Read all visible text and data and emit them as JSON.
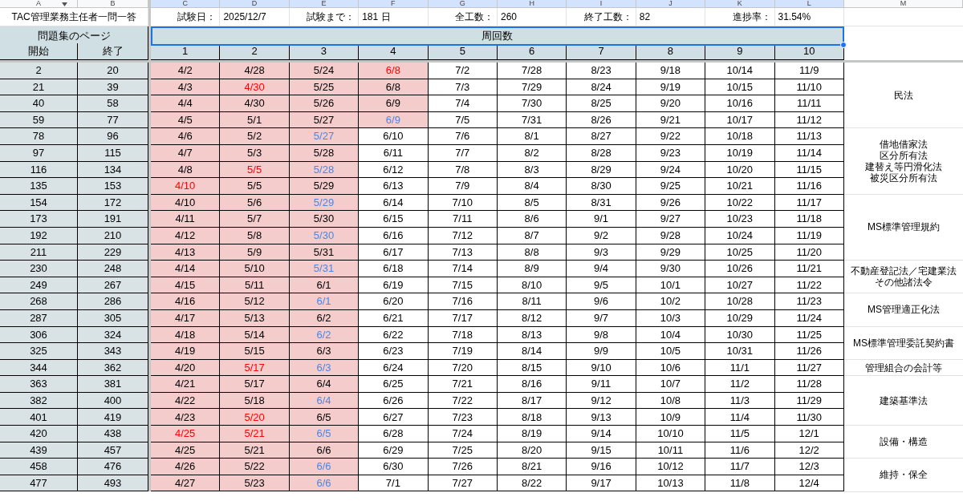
{
  "column_letters": [
    {
      "text": "A",
      "selected": false
    },
    {
      "text": "B",
      "selected": false
    },
    {
      "text": "C",
      "selected": true
    },
    {
      "text": "D",
      "selected": true
    },
    {
      "text": "E",
      "selected": true
    },
    {
      "text": "F",
      "selected": true
    },
    {
      "text": "G",
      "selected": true
    },
    {
      "text": "H",
      "selected": true
    },
    {
      "text": "I",
      "selected": true
    },
    {
      "text": "J",
      "selected": true
    },
    {
      "text": "K",
      "selected": true
    },
    {
      "text": "L",
      "selected": true
    },
    {
      "text": "M",
      "selected": false
    }
  ],
  "title": "TAC管理業務主任者一問一答",
  "exam_info": [
    {
      "label": "試験日：",
      "value": "2025/12/7"
    },
    {
      "label": "試験まで：",
      "value": "181 日"
    },
    {
      "label": "全工数：",
      "value": "260"
    },
    {
      "label": "終了工数：",
      "value": "82"
    },
    {
      "label": "進捗率：",
      "value": "31.54%"
    }
  ],
  "pages_header": "問題集のページ",
  "rounds_header": "周回数",
  "start_label": "開始",
  "end_label": "終了",
  "round_numbers": [
    "1",
    "2",
    "3",
    "4",
    "5",
    "6",
    "7",
    "8",
    "9",
    "10"
  ],
  "groups": [
    {
      "lines": [
        "民法"
      ],
      "rows": [
        {
          "start": "2",
          "end": "20",
          "cells": [
            {
              "text": "4/2",
              "done": true,
              "color": "#000000"
            },
            {
              "text": "4/28",
              "done": true,
              "color": "#000000"
            },
            {
              "text": "5/24",
              "done": true,
              "color": "#000000"
            },
            {
              "text": "6/8",
              "done": true,
              "color": "#ff0000"
            },
            {
              "text": "7/2",
              "done": false,
              "color": "#000000"
            },
            {
              "text": "7/28",
              "done": false,
              "color": "#000000"
            },
            {
              "text": "8/23",
              "done": false,
              "color": "#000000"
            },
            {
              "text": "9/18",
              "done": false,
              "color": "#000000"
            },
            {
              "text": "10/14",
              "done": false,
              "color": "#000000"
            },
            {
              "text": "11/9",
              "done": false,
              "color": "#000000"
            }
          ]
        },
        {
          "start": "21",
          "end": "39",
          "cells": [
            {
              "text": "4/3",
              "done": true,
              "color": "#000000"
            },
            {
              "text": "4/30",
              "done": true,
              "color": "#ff0000"
            },
            {
              "text": "5/25",
              "done": true,
              "color": "#000000"
            },
            {
              "text": "6/8",
              "done": true,
              "color": "#000000"
            },
            {
              "text": "7/3",
              "done": false,
              "color": "#000000"
            },
            {
              "text": "7/29",
              "done": false,
              "color": "#000000"
            },
            {
              "text": "8/24",
              "done": false,
              "color": "#000000"
            },
            {
              "text": "9/19",
              "done": false,
              "color": "#000000"
            },
            {
              "text": "10/15",
              "done": false,
              "color": "#000000"
            },
            {
              "text": "11/10",
              "done": false,
              "color": "#000000"
            }
          ]
        },
        {
          "start": "40",
          "end": "58",
          "cells": [
            {
              "text": "4/4",
              "done": true,
              "color": "#000000"
            },
            {
              "text": "4/30",
              "done": true,
              "color": "#000000"
            },
            {
              "text": "5/26",
              "done": true,
              "color": "#000000"
            },
            {
              "text": "6/9",
              "done": true,
              "color": "#000000"
            },
            {
              "text": "7/4",
              "done": false,
              "color": "#000000"
            },
            {
              "text": "7/30",
              "done": false,
              "color": "#000000"
            },
            {
              "text": "8/25",
              "done": false,
              "color": "#000000"
            },
            {
              "text": "9/20",
              "done": false,
              "color": "#000000"
            },
            {
              "text": "10/16",
              "done": false,
              "color": "#000000"
            },
            {
              "text": "11/11",
              "done": false,
              "color": "#000000"
            }
          ]
        },
        {
          "start": "59",
          "end": "77",
          "cells": [
            {
              "text": "4/5",
              "done": true,
              "color": "#000000"
            },
            {
              "text": "5/1",
              "done": true,
              "color": "#000000"
            },
            {
              "text": "5/27",
              "done": true,
              "color": "#000000"
            },
            {
              "text": "6/9",
              "done": true,
              "color": "#4a86e8"
            },
            {
              "text": "7/5",
              "done": false,
              "color": "#000000"
            },
            {
              "text": "7/31",
              "done": false,
              "color": "#000000"
            },
            {
              "text": "8/26",
              "done": false,
              "color": "#000000"
            },
            {
              "text": "9/21",
              "done": false,
              "color": "#000000"
            },
            {
              "text": "10/17",
              "done": false,
              "color": "#000000"
            },
            {
              "text": "11/12",
              "done": false,
              "color": "#000000"
            }
          ]
        }
      ]
    },
    {
      "lines": [
        "借地借家法",
        "区分所有法",
        "建替え等円滑化法",
        "被災区分所有法"
      ],
      "rows": [
        {
          "start": "78",
          "end": "96",
          "cells": [
            {
              "text": "4/6",
              "done": true,
              "color": "#000000"
            },
            {
              "text": "5/2",
              "done": true,
              "color": "#000000"
            },
            {
              "text": "5/27",
              "done": true,
              "color": "#4a86e8"
            },
            {
              "text": "6/10",
              "done": false,
              "color": "#000000"
            },
            {
              "text": "7/6",
              "done": false,
              "color": "#000000"
            },
            {
              "text": "8/1",
              "done": false,
              "color": "#000000"
            },
            {
              "text": "8/27",
              "done": false,
              "color": "#000000"
            },
            {
              "text": "9/22",
              "done": false,
              "color": "#000000"
            },
            {
              "text": "10/18",
              "done": false,
              "color": "#000000"
            },
            {
              "text": "11/13",
              "done": false,
              "color": "#000000"
            }
          ]
        },
        {
          "start": "97",
          "end": "115",
          "cells": [
            {
              "text": "4/7",
              "done": true,
              "color": "#000000"
            },
            {
              "text": "5/3",
              "done": true,
              "color": "#000000"
            },
            {
              "text": "5/28",
              "done": true,
              "color": "#000000"
            },
            {
              "text": "6/11",
              "done": false,
              "color": "#000000"
            },
            {
              "text": "7/7",
              "done": false,
              "color": "#000000"
            },
            {
              "text": "8/2",
              "done": false,
              "color": "#000000"
            },
            {
              "text": "8/28",
              "done": false,
              "color": "#000000"
            },
            {
              "text": "9/23",
              "done": false,
              "color": "#000000"
            },
            {
              "text": "10/19",
              "done": false,
              "color": "#000000"
            },
            {
              "text": "11/14",
              "done": false,
              "color": "#000000"
            }
          ]
        },
        {
          "start": "116",
          "end": "134",
          "cells": [
            {
              "text": "4/8",
              "done": true,
              "color": "#000000"
            },
            {
              "text": "5/5",
              "done": true,
              "color": "#ff0000"
            },
            {
              "text": "5/28",
              "done": true,
              "color": "#4a86e8"
            },
            {
              "text": "6/12",
              "done": false,
              "color": "#000000"
            },
            {
              "text": "7/8",
              "done": false,
              "color": "#000000"
            },
            {
              "text": "8/3",
              "done": false,
              "color": "#000000"
            },
            {
              "text": "8/29",
              "done": false,
              "color": "#000000"
            },
            {
              "text": "9/24",
              "done": false,
              "color": "#000000"
            },
            {
              "text": "10/20",
              "done": false,
              "color": "#000000"
            },
            {
              "text": "11/15",
              "done": false,
              "color": "#000000"
            }
          ]
        },
        {
          "start": "135",
          "end": "153",
          "cells": [
            {
              "text": "4/10",
              "done": true,
              "color": "#ff0000"
            },
            {
              "text": "5/5",
              "done": true,
              "color": "#000000"
            },
            {
              "text": "5/29",
              "done": true,
              "color": "#000000"
            },
            {
              "text": "6/13",
              "done": false,
              "color": "#000000"
            },
            {
              "text": "7/9",
              "done": false,
              "color": "#000000"
            },
            {
              "text": "8/4",
              "done": false,
              "color": "#000000"
            },
            {
              "text": "8/30",
              "done": false,
              "color": "#000000"
            },
            {
              "text": "9/25",
              "done": false,
              "color": "#000000"
            },
            {
              "text": "10/21",
              "done": false,
              "color": "#000000"
            },
            {
              "text": "11/16",
              "done": false,
              "color": "#000000"
            }
          ]
        }
      ]
    },
    {
      "lines": [
        "MS標準管理規約"
      ],
      "rows": [
        {
          "start": "154",
          "end": "172",
          "cells": [
            {
              "text": "4/10",
              "done": true,
              "color": "#000000"
            },
            {
              "text": "5/6",
              "done": true,
              "color": "#000000"
            },
            {
              "text": "5/29",
              "done": true,
              "color": "#4a86e8"
            },
            {
              "text": "6/14",
              "done": false,
              "color": "#000000"
            },
            {
              "text": "7/10",
              "done": false,
              "color": "#000000"
            },
            {
              "text": "8/5",
              "done": false,
              "color": "#000000"
            },
            {
              "text": "8/31",
              "done": false,
              "color": "#000000"
            },
            {
              "text": "9/26",
              "done": false,
              "color": "#000000"
            },
            {
              "text": "10/22",
              "done": false,
              "color": "#000000"
            },
            {
              "text": "11/17",
              "done": false,
              "color": "#000000"
            }
          ]
        },
        {
          "start": "173",
          "end": "191",
          "cells": [
            {
              "text": "4/11",
              "done": true,
              "color": "#000000"
            },
            {
              "text": "5/7",
              "done": true,
              "color": "#000000"
            },
            {
              "text": "5/30",
              "done": true,
              "color": "#000000"
            },
            {
              "text": "6/15",
              "done": false,
              "color": "#000000"
            },
            {
              "text": "7/11",
              "done": false,
              "color": "#000000"
            },
            {
              "text": "8/6",
              "done": false,
              "color": "#000000"
            },
            {
              "text": "9/1",
              "done": false,
              "color": "#000000"
            },
            {
              "text": "9/27",
              "done": false,
              "color": "#000000"
            },
            {
              "text": "10/23",
              "done": false,
              "color": "#000000"
            },
            {
              "text": "11/18",
              "done": false,
              "color": "#000000"
            }
          ]
        },
        {
          "start": "192",
          "end": "210",
          "cells": [
            {
              "text": "4/12",
              "done": true,
              "color": "#000000"
            },
            {
              "text": "5/8",
              "done": true,
              "color": "#000000"
            },
            {
              "text": "5/30",
              "done": true,
              "color": "#4a86e8"
            },
            {
              "text": "6/16",
              "done": false,
              "color": "#000000"
            },
            {
              "text": "7/12",
              "done": false,
              "color": "#000000"
            },
            {
              "text": "8/7",
              "done": false,
              "color": "#000000"
            },
            {
              "text": "9/2",
              "done": false,
              "color": "#000000"
            },
            {
              "text": "9/28",
              "done": false,
              "color": "#000000"
            },
            {
              "text": "10/24",
              "done": false,
              "color": "#000000"
            },
            {
              "text": "11/19",
              "done": false,
              "color": "#000000"
            }
          ]
        },
        {
          "start": "211",
          "end": "229",
          "cells": [
            {
              "text": "4/13",
              "done": true,
              "color": "#000000"
            },
            {
              "text": "5/9",
              "done": true,
              "color": "#000000"
            },
            {
              "text": "5/31",
              "done": true,
              "color": "#000000"
            },
            {
              "text": "6/17",
              "done": false,
              "color": "#000000"
            },
            {
              "text": "7/13",
              "done": false,
              "color": "#000000"
            },
            {
              "text": "8/8",
              "done": false,
              "color": "#000000"
            },
            {
              "text": "9/3",
              "done": false,
              "color": "#000000"
            },
            {
              "text": "9/29",
              "done": false,
              "color": "#000000"
            },
            {
              "text": "10/25",
              "done": false,
              "color": "#000000"
            },
            {
              "text": "11/20",
              "done": false,
              "color": "#000000"
            }
          ]
        }
      ]
    },
    {
      "lines": [
        "不動産登記法／宅建業法",
        "その他諸法令"
      ],
      "rows": [
        {
          "start": "230",
          "end": "248",
          "cells": [
            {
              "text": "4/14",
              "done": true,
              "color": "#000000"
            },
            {
              "text": "5/10",
              "done": true,
              "color": "#000000"
            },
            {
              "text": "5/31",
              "done": true,
              "color": "#4a86e8"
            },
            {
              "text": "6/18",
              "done": false,
              "color": "#000000"
            },
            {
              "text": "7/14",
              "done": false,
              "color": "#000000"
            },
            {
              "text": "8/9",
              "done": false,
              "color": "#000000"
            },
            {
              "text": "9/4",
              "done": false,
              "color": "#000000"
            },
            {
              "text": "9/30",
              "done": false,
              "color": "#000000"
            },
            {
              "text": "10/26",
              "done": false,
              "color": "#000000"
            },
            {
              "text": "11/21",
              "done": false,
              "color": "#000000"
            }
          ]
        },
        {
          "start": "249",
          "end": "267",
          "cells": [
            {
              "text": "4/15",
              "done": true,
              "color": "#000000"
            },
            {
              "text": "5/11",
              "done": true,
              "color": "#000000"
            },
            {
              "text": "6/1",
              "done": true,
              "color": "#000000"
            },
            {
              "text": "6/19",
              "done": false,
              "color": "#000000"
            },
            {
              "text": "7/15",
              "done": false,
              "color": "#000000"
            },
            {
              "text": "8/10",
              "done": false,
              "color": "#000000"
            },
            {
              "text": "9/5",
              "done": false,
              "color": "#000000"
            },
            {
              "text": "10/1",
              "done": false,
              "color": "#000000"
            },
            {
              "text": "10/27",
              "done": false,
              "color": "#000000"
            },
            {
              "text": "11/22",
              "done": false,
              "color": "#000000"
            }
          ]
        }
      ]
    },
    {
      "lines": [
        "MS管理適正化法"
      ],
      "rows": [
        {
          "start": "268",
          "end": "286",
          "cells": [
            {
              "text": "4/16",
              "done": true,
              "color": "#000000"
            },
            {
              "text": "5/12",
              "done": true,
              "color": "#000000"
            },
            {
              "text": "6/1",
              "done": true,
              "color": "#4a86e8"
            },
            {
              "text": "6/20",
              "done": false,
              "color": "#000000"
            },
            {
              "text": "7/16",
              "done": false,
              "color": "#000000"
            },
            {
              "text": "8/11",
              "done": false,
              "color": "#000000"
            },
            {
              "text": "9/6",
              "done": false,
              "color": "#000000"
            },
            {
              "text": "10/2",
              "done": false,
              "color": "#000000"
            },
            {
              "text": "10/28",
              "done": false,
              "color": "#000000"
            },
            {
              "text": "11/23",
              "done": false,
              "color": "#000000"
            }
          ]
        },
        {
          "start": "287",
          "end": "305",
          "cells": [
            {
              "text": "4/17",
              "done": true,
              "color": "#000000"
            },
            {
              "text": "5/13",
              "done": true,
              "color": "#000000"
            },
            {
              "text": "6/2",
              "done": true,
              "color": "#000000"
            },
            {
              "text": "6/21",
              "done": false,
              "color": "#000000"
            },
            {
              "text": "7/17",
              "done": false,
              "color": "#000000"
            },
            {
              "text": "8/12",
              "done": false,
              "color": "#000000"
            },
            {
              "text": "9/7",
              "done": false,
              "color": "#000000"
            },
            {
              "text": "10/3",
              "done": false,
              "color": "#000000"
            },
            {
              "text": "10/29",
              "done": false,
              "color": "#000000"
            },
            {
              "text": "11/24",
              "done": false,
              "color": "#000000"
            }
          ]
        }
      ]
    },
    {
      "lines": [
        "MS標準管理委託契約書"
      ],
      "rows": [
        {
          "start": "306",
          "end": "324",
          "cells": [
            {
              "text": "4/18",
              "done": true,
              "color": "#000000"
            },
            {
              "text": "5/14",
              "done": true,
              "color": "#000000"
            },
            {
              "text": "6/2",
              "done": true,
              "color": "#4a86e8"
            },
            {
              "text": "6/22",
              "done": false,
              "color": "#000000"
            },
            {
              "text": "7/18",
              "done": false,
              "color": "#000000"
            },
            {
              "text": "8/13",
              "done": false,
              "color": "#000000"
            },
            {
              "text": "9/8",
              "done": false,
              "color": "#000000"
            },
            {
              "text": "10/4",
              "done": false,
              "color": "#000000"
            },
            {
              "text": "10/30",
              "done": false,
              "color": "#000000"
            },
            {
              "text": "11/25",
              "done": false,
              "color": "#000000"
            }
          ]
        },
        {
          "start": "325",
          "end": "343",
          "cells": [
            {
              "text": "4/19",
              "done": true,
              "color": "#000000"
            },
            {
              "text": "5/15",
              "done": true,
              "color": "#000000"
            },
            {
              "text": "6/3",
              "done": true,
              "color": "#000000"
            },
            {
              "text": "6/23",
              "done": false,
              "color": "#000000"
            },
            {
              "text": "7/19",
              "done": false,
              "color": "#000000"
            },
            {
              "text": "8/14",
              "done": false,
              "color": "#000000"
            },
            {
              "text": "9/9",
              "done": false,
              "color": "#000000"
            },
            {
              "text": "10/5",
              "done": false,
              "color": "#000000"
            },
            {
              "text": "10/31",
              "done": false,
              "color": "#000000"
            },
            {
              "text": "11/26",
              "done": false,
              "color": "#000000"
            }
          ]
        }
      ]
    },
    {
      "lines": [
        "管理組合の会計等"
      ],
      "rows": [
        {
          "start": "344",
          "end": "362",
          "cells": [
            {
              "text": "4/20",
              "done": true,
              "color": "#000000"
            },
            {
              "text": "5/17",
              "done": true,
              "color": "#ff0000"
            },
            {
              "text": "6/3",
              "done": true,
              "color": "#4a86e8"
            },
            {
              "text": "6/24",
              "done": false,
              "color": "#000000"
            },
            {
              "text": "7/20",
              "done": false,
              "color": "#000000"
            },
            {
              "text": "8/15",
              "done": false,
              "color": "#000000"
            },
            {
              "text": "9/10",
              "done": false,
              "color": "#000000"
            },
            {
              "text": "10/6",
              "done": false,
              "color": "#000000"
            },
            {
              "text": "11/1",
              "done": false,
              "color": "#000000"
            },
            {
              "text": "11/27",
              "done": false,
              "color": "#000000"
            }
          ]
        }
      ]
    },
    {
      "lines": [
        "建築基準法"
      ],
      "rows": [
        {
          "start": "363",
          "end": "381",
          "cells": [
            {
              "text": "4/21",
              "done": true,
              "color": "#000000"
            },
            {
              "text": "5/17",
              "done": true,
              "color": "#000000"
            },
            {
              "text": "6/4",
              "done": true,
              "color": "#000000"
            },
            {
              "text": "6/25",
              "done": false,
              "color": "#000000"
            },
            {
              "text": "7/21",
              "done": false,
              "color": "#000000"
            },
            {
              "text": "8/16",
              "done": false,
              "color": "#000000"
            },
            {
              "text": "9/11",
              "done": false,
              "color": "#000000"
            },
            {
              "text": "10/7",
              "done": false,
              "color": "#000000"
            },
            {
              "text": "11/2",
              "done": false,
              "color": "#000000"
            },
            {
              "text": "11/28",
              "done": false,
              "color": "#000000"
            }
          ]
        },
        {
          "start": "382",
          "end": "400",
          "cells": [
            {
              "text": "4/22",
              "done": true,
              "color": "#000000"
            },
            {
              "text": "5/18",
              "done": true,
              "color": "#000000"
            },
            {
              "text": "6/4",
              "done": true,
              "color": "#4a86e8"
            },
            {
              "text": "6/26",
              "done": false,
              "color": "#000000"
            },
            {
              "text": "7/22",
              "done": false,
              "color": "#000000"
            },
            {
              "text": "8/17",
              "done": false,
              "color": "#000000"
            },
            {
              "text": "9/12",
              "done": false,
              "color": "#000000"
            },
            {
              "text": "10/8",
              "done": false,
              "color": "#000000"
            },
            {
              "text": "11/3",
              "done": false,
              "color": "#000000"
            },
            {
              "text": "11/29",
              "done": false,
              "color": "#000000"
            }
          ]
        },
        {
          "start": "401",
          "end": "419",
          "cells": [
            {
              "text": "4/23",
              "done": true,
              "color": "#000000"
            },
            {
              "text": "5/20",
              "done": true,
              "color": "#ff0000"
            },
            {
              "text": "6/5",
              "done": true,
              "color": "#000000"
            },
            {
              "text": "6/27",
              "done": false,
              "color": "#000000"
            },
            {
              "text": "7/23",
              "done": false,
              "color": "#000000"
            },
            {
              "text": "8/18",
              "done": false,
              "color": "#000000"
            },
            {
              "text": "9/13",
              "done": false,
              "color": "#000000"
            },
            {
              "text": "10/9",
              "done": false,
              "color": "#000000"
            },
            {
              "text": "11/4",
              "done": false,
              "color": "#000000"
            },
            {
              "text": "11/30",
              "done": false,
              "color": "#000000"
            }
          ]
        }
      ]
    },
    {
      "lines": [
        "設備・構造"
      ],
      "rows": [
        {
          "start": "420",
          "end": "438",
          "cells": [
            {
              "text": "4/25",
              "done": true,
              "color": "#ff0000"
            },
            {
              "text": "5/21",
              "done": true,
              "color": "#ff0000"
            },
            {
              "text": "6/5",
              "done": true,
              "color": "#4a86e8"
            },
            {
              "text": "6/28",
              "done": false,
              "color": "#000000"
            },
            {
              "text": "7/24",
              "done": false,
              "color": "#000000"
            },
            {
              "text": "8/19",
              "done": false,
              "color": "#000000"
            },
            {
              "text": "9/14",
              "done": false,
              "color": "#000000"
            },
            {
              "text": "10/10",
              "done": false,
              "color": "#000000"
            },
            {
              "text": "11/5",
              "done": false,
              "color": "#000000"
            },
            {
              "text": "12/1",
              "done": false,
              "color": "#000000"
            }
          ]
        },
        {
          "start": "439",
          "end": "457",
          "cells": [
            {
              "text": "4/25",
              "done": true,
              "color": "#000000"
            },
            {
              "text": "5/21",
              "done": true,
              "color": "#000000"
            },
            {
              "text": "6/6",
              "done": true,
              "color": "#000000"
            },
            {
              "text": "6/29",
              "done": false,
              "color": "#000000"
            },
            {
              "text": "7/25",
              "done": false,
              "color": "#000000"
            },
            {
              "text": "8/20",
              "done": false,
              "color": "#000000"
            },
            {
              "text": "9/15",
              "done": false,
              "color": "#000000"
            },
            {
              "text": "10/11",
              "done": false,
              "color": "#000000"
            },
            {
              "text": "11/6",
              "done": false,
              "color": "#000000"
            },
            {
              "text": "12/2",
              "done": false,
              "color": "#000000"
            }
          ]
        }
      ]
    },
    {
      "lines": [
        "維持・保全"
      ],
      "rows": [
        {
          "start": "458",
          "end": "476",
          "cells": [
            {
              "text": "4/26",
              "done": true,
              "color": "#000000"
            },
            {
              "text": "5/22",
              "done": true,
              "color": "#000000"
            },
            {
              "text": "6/6",
              "done": true,
              "color": "#4a86e8"
            },
            {
              "text": "6/30",
              "done": false,
              "color": "#000000"
            },
            {
              "text": "7/26",
              "done": false,
              "color": "#000000"
            },
            {
              "text": "8/21",
              "done": false,
              "color": "#000000"
            },
            {
              "text": "9/16",
              "done": false,
              "color": "#000000"
            },
            {
              "text": "10/12",
              "done": false,
              "color": "#000000"
            },
            {
              "text": "11/7",
              "done": false,
              "color": "#000000"
            },
            {
              "text": "12/3",
              "done": false,
              "color": "#000000"
            }
          ]
        },
        {
          "start": "477",
          "end": "493",
          "cells": [
            {
              "text": "4/27",
              "done": true,
              "color": "#000000"
            },
            {
              "text": "5/23",
              "done": true,
              "color": "#000000"
            },
            {
              "text": "6/6",
              "done": true,
              "color": "#4a86e8"
            },
            {
              "text": "7/1",
              "done": false,
              "color": "#000000"
            },
            {
              "text": "7/27",
              "done": false,
              "color": "#000000"
            },
            {
              "text": "8/22",
              "done": false,
              "color": "#000000"
            },
            {
              "text": "9/17",
              "done": false,
              "color": "#000000"
            },
            {
              "text": "10/13",
              "done": false,
              "color": "#000000"
            },
            {
              "text": "11/8",
              "done": false,
              "color": "#000000"
            },
            {
              "text": "12/4",
              "done": false,
              "color": "#000000"
            }
          ]
        }
      ]
    }
  ]
}
